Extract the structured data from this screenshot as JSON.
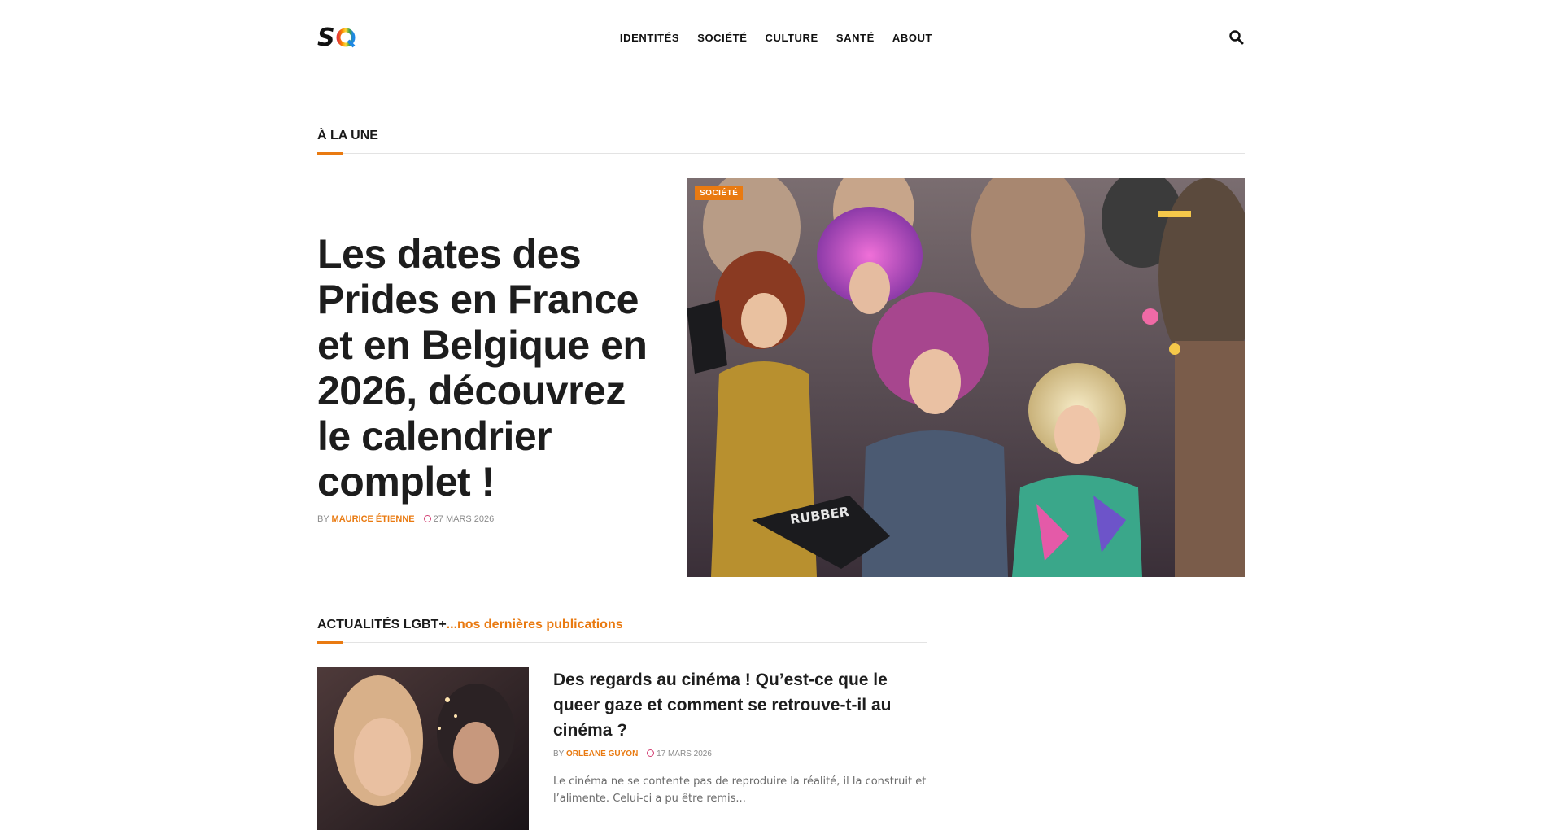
{
  "site": {
    "logo_text": "SQ",
    "colors": {
      "accent": "#e97a11",
      "date_icon": "#d23d72",
      "text": "#212121"
    }
  },
  "nav": {
    "items": [
      {
        "label": "IDENTITÉS"
      },
      {
        "label": "SOCIÉTÉ"
      },
      {
        "label": "CULTURE"
      },
      {
        "label": "SANTÉ"
      },
      {
        "label": "ABOUT"
      }
    ],
    "search_icon": "search-icon"
  },
  "featured": {
    "section_title": "À LA UNE",
    "category": "SOCIÉTÉ",
    "title": "Les dates des Prides en France et en Belgique en 2026, découvrez le calendrier complet !",
    "by": "BY",
    "author": "MAURICE ÉTIENNE",
    "date": "27 MARS 2026"
  },
  "latest": {
    "section_title": "ACTUALITÉS LGBT+",
    "section_accent": "...nos dernières publications",
    "articles": [
      {
        "title": "Des regards au cinéma ! Qu’est-ce que le queer gaze et comment se retrouve-t-il au cinéma ?",
        "by": "BY",
        "author": "ORLEANE GUYON",
        "date": "17 MARS 2026",
        "excerpt": "Le cinéma ne se contente pas de reproduire la réalité, il la construit et l’alimente. Celui-ci a pu être remis..."
      }
    ]
  }
}
